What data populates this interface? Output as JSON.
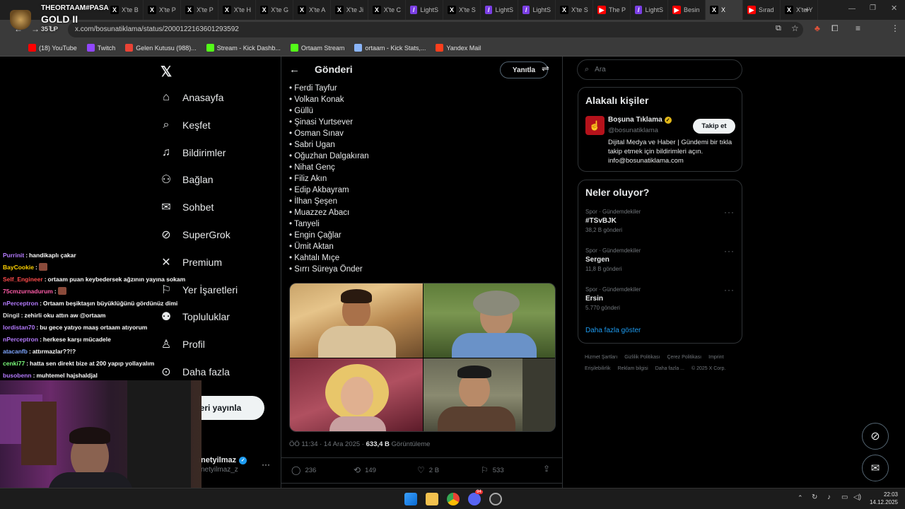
{
  "browser": {
    "tabs": [
      {
        "label": "X'te B",
        "icon": "x",
        "color": "#000"
      },
      {
        "label": "X'te P",
        "icon": "x",
        "color": "#000"
      },
      {
        "label": "X'te P",
        "icon": "x",
        "color": "#000"
      },
      {
        "label": "X'te H",
        "icon": "x",
        "color": "#000"
      },
      {
        "label": "X'te G",
        "icon": "x",
        "color": "#000"
      },
      {
        "label": "X'te A",
        "icon": "x",
        "color": "#000"
      },
      {
        "label": "X'te Ji",
        "icon": "x",
        "color": "#000"
      },
      {
        "label": "X'te C",
        "icon": "x",
        "color": "#000"
      },
      {
        "label": "LightS",
        "icon": "/",
        "color": "#7b3fe4"
      },
      {
        "label": "X'te S",
        "icon": "x",
        "color": "#000"
      },
      {
        "label": "LightS",
        "icon": "/",
        "color": "#7b3fe4"
      },
      {
        "label": "LightS",
        "icon": "/",
        "color": "#7b3fe4"
      },
      {
        "label": "X'te S",
        "icon": "x",
        "color": "#000"
      },
      {
        "label": "The P",
        "icon": "▶",
        "color": "#ff0000"
      },
      {
        "label": "LightS",
        "icon": "/",
        "color": "#7b3fe4"
      },
      {
        "label": "Besin",
        "icon": "▶",
        "color": "#ff0000"
      },
      {
        "label": "X",
        "icon": "x",
        "color": "#000",
        "active": true
      },
      {
        "label": "Sırad",
        "icon": "▶",
        "color": "#ff0000"
      },
      {
        "label": "X'te Y",
        "icon": "x",
        "color": "#000"
      }
    ],
    "url": "x.com/bosunatiklama/status/2000122163601293592",
    "bookmarks": [
      {
        "label": "(18) YouTube",
        "color": "#ff0000"
      },
      {
        "label": "Twitch",
        "color": "#9146ff"
      },
      {
        "label": "Gelen Kutusu (988)...",
        "color": "#ea4335"
      },
      {
        "label": "Stream - Kick Dashb...",
        "color": "#53fc18"
      },
      {
        "label": "Ortaam Stream",
        "color": "#53fc18"
      },
      {
        "label": "ortaam - Kick Stats,...",
        "color": "#8ab4f8"
      },
      {
        "label": "Yandex Mail",
        "color": "#fc3f1d"
      }
    ]
  },
  "overlay": {
    "streamer_tag": "THEORTAAM#PASA",
    "rank": "GOLD II",
    "lp": "35 LP",
    "chat": [
      {
        "user": "Purrinit",
        "user_color": "#b57bff",
        "msg": "handikaplı çakar"
      },
      {
        "user": "BayCookie",
        "user_color": "#ffd200",
        "msg": ""
      },
      {
        "user": "Self_Engineer",
        "user_color": "#ff4b4b",
        "msg": "ortaam puan keybedersek ağzının yayına sokam"
      },
      {
        "user": "75cmzurnadurum",
        "user_color": "#ff5ca8",
        "msg": ""
      },
      {
        "user": "nPerceptron",
        "user_color": "#b57bff",
        "msg": "Ortaam beşiktaşın büyüklüğünü gördünüz dimi"
      },
      {
        "user": "Dingil",
        "user_color": "#e0e0e0",
        "msg": "zehirli oku attın aw @ortaam"
      },
      {
        "user": "lordistan70",
        "user_color": "#b57bff",
        "msg": "bu gece yatıyo maaş ortaam atıyorum"
      },
      {
        "user": "nPerceptron",
        "user_color": "#b57bff",
        "msg": "herkese karşı mücadele"
      },
      {
        "user": "atacanfb",
        "user_color": "#7fa6ff",
        "msg": "attırmazlar??!?"
      },
      {
        "user": "cenki77",
        "user_color": "#7cff7c",
        "msg": "hatta sen direkt bize at 200 yapıp yollayalım"
      },
      {
        "user": "busobenn",
        "user_color": "#b57bff",
        "msg": "muhtemel hajshaldjal"
      }
    ]
  },
  "nav": {
    "items": [
      {
        "label": "Anasayfa",
        "icon": "home-icon"
      },
      {
        "label": "Keşfet",
        "icon": "search-icon"
      },
      {
        "label": "Bildirimler",
        "icon": "bell-icon"
      },
      {
        "label": "Bağlan",
        "icon": "add-person-icon"
      },
      {
        "label": "Sohbet",
        "icon": "mail-icon"
      },
      {
        "label": "SuperGrok",
        "icon": "grok-icon"
      },
      {
        "label": "Premium",
        "icon": "x-logo-icon"
      },
      {
        "label": "Yer İşaretleri",
        "icon": "bookmark-icon"
      },
      {
        "label": "Topluluklar",
        "icon": "people-icon"
      },
      {
        "label": "Profil",
        "icon": "person-icon"
      },
      {
        "label": "Daha fazla",
        "icon": "more-circle-icon"
      }
    ],
    "post_button": "Gönderi yayınla",
    "post_button_visible": "eri yayınla",
    "account_name": "netyilmaz",
    "account_handle": "netyilmaz_z",
    "account_more": "···"
  },
  "post": {
    "header_title": "Gönderi",
    "reply_button": "Yanıtla",
    "names": [
      "• Ferdi Tayfur",
      "• Volkan Konak",
      "• Güllü",
      "• Şinasi Yurtsever",
      "• Osman Sınav",
      "• Sabri Ugan",
      "• Oğuzhan Dalgakıran",
      "• Nihat Genç",
      "• Filiz Akın",
      "• Edip Akbayram",
      "• İlhan Şeşen",
      "• Muazzez Abacı",
      "• Tanyeli",
      "• Engin Çağlar",
      "• Ümit Aktan",
      "• Kahtalı Mıçe",
      "• Sırrı Süreya Önder"
    ],
    "timestamp": "ÖÖ 11:34 · 14 Ara 2025 · ",
    "views": "633,4 B",
    "views_label": " Görüntüleme",
    "stats": {
      "replies": "236",
      "reposts": "149",
      "likes": "2 B",
      "bookmarks": "533"
    }
  },
  "sidebar": {
    "search_placeholder": "Ara",
    "related_title": "Alakalı kişiler",
    "related": {
      "name": "Boşuna Tıklama",
      "handle": "@bosunatiklama",
      "follow_label": "Takip et",
      "bio": "Dijital Medya ve Haber | Gündemi bir tıkla takip etmek için bildirimleri açın. info@bosunatiklama.com"
    },
    "trends_title": "Neler oluyor?",
    "trends": [
      {
        "meta": "Spor · Gündemdekiler",
        "title": "#TSvBJK",
        "count": "38,2 B gönderi"
      },
      {
        "meta": "Spor · Gündemdekiler",
        "title": "Sergen",
        "count": "11,8 B gönderi"
      },
      {
        "meta": "Spor · Gündemdekiler",
        "title": "Ersin",
        "count": "5.770 gönderi"
      }
    ],
    "show_more": "Daha fazla göster",
    "footer": [
      "Hizmet Şartları",
      "Gizlilik Politikası",
      "Çerez Politikası",
      "Imprint",
      "Erişilebilirlik",
      "Reklam bilgisi",
      "Daha fazla ...",
      "© 2025 X Corp."
    ]
  },
  "taskbar": {
    "time": "22:03",
    "date": "14.12.2025",
    "discord_badge": "94"
  },
  "colors": {
    "accent": "#1d9bf0",
    "verified": "#1d9bf0",
    "border": "#2f3336",
    "muted": "#71767b"
  }
}
